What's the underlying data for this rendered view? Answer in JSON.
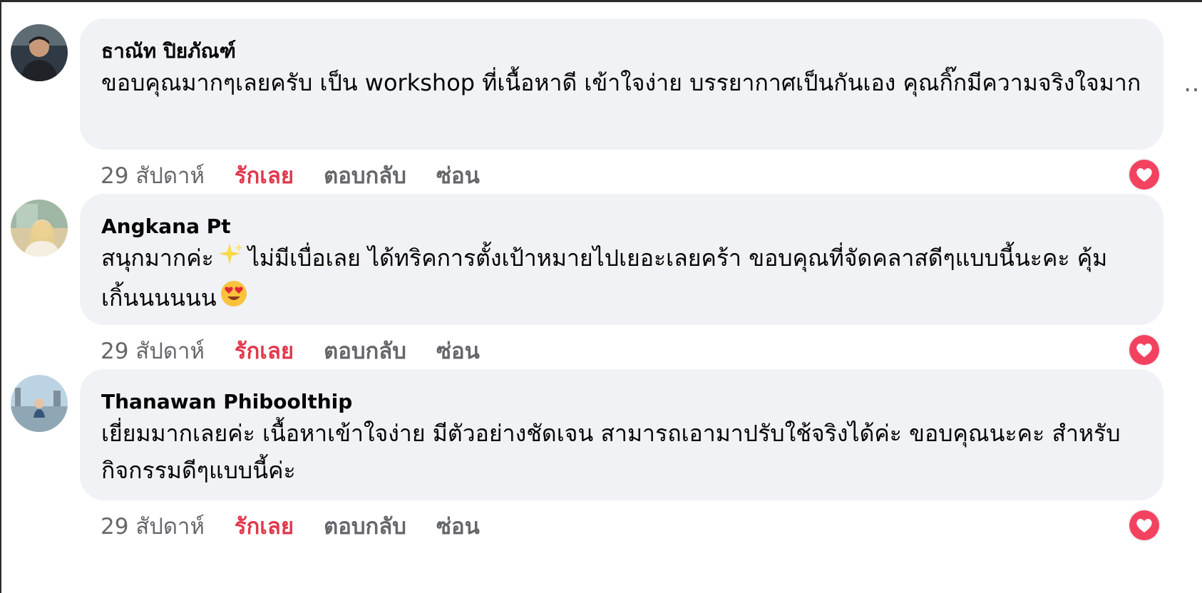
{
  "comments": [
    {
      "author": "ธาณัท ปิยภัณฑ์",
      "text": "ขอบคุณมากๆเลยครับ เป็น workshop ที่เนื้อหาดี เข้าใจง่าย บรรยากาศเป็นกันเอง คุณกิ๊กมีความจริงใจมาก",
      "time": "29 สัปดาห์",
      "love_label": "รักเลย",
      "reply_label": "ตอบกลับ",
      "hide_label": "ซ่อน",
      "more_icon": "…"
    },
    {
      "author": "Angkana Pt",
      "text_part1": "สนุกมากค่ะ",
      "text_part2": "ไม่มีเบื่อเลย ได้ทริคการตั้งเป้าหมายไปเยอะเลยคร้า ขอบคุณที่จัดคลาสดีๆแบบนี้นะคะ คุ้มเกิ้นนนนนน",
      "time": "29 สัปดาห์",
      "love_label": "รักเลย",
      "reply_label": "ตอบกลับ",
      "hide_label": "ซ่อน"
    },
    {
      "author": "Thanawan Phiboolthip",
      "text": "เยี่ยมมากเลยค่ะ เนื้อหาเข้าใจง่าย มีตัวอย่างชัดเจน สามารถเอามาปรับใช้จริงได้ค่ะ ขอบคุณนะคะ สำหรับกิจกรรมดีๆแบบนี้ค่ะ",
      "time": "29 สัปดาห์",
      "love_label": "รักเลย",
      "reply_label": "ตอบกลับ",
      "hide_label": "ซ่อน"
    }
  ],
  "icons": {
    "reaction": "heart-reaction-icon",
    "sparkles": "sparkles-emoji",
    "heart_eyes": "heart-eyes-emoji"
  },
  "colors": {
    "bubble": "#f0f2f5",
    "love": "#e0394d",
    "meta": "#65676b",
    "text": "#050505"
  }
}
